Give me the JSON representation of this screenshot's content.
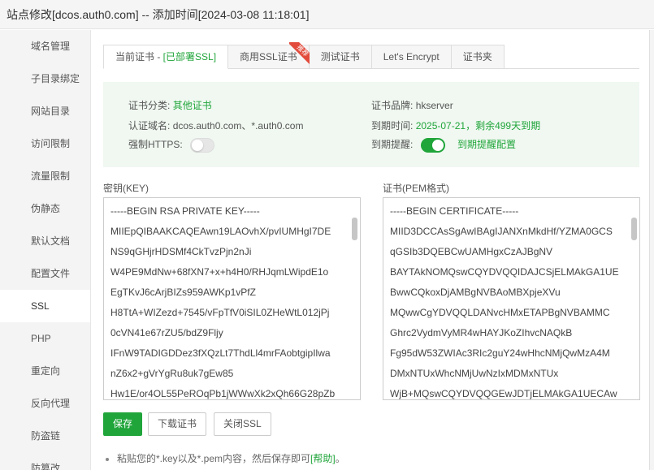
{
  "window": {
    "title": "站点修改[dcos.auth0.com] -- 添加时间[2024-03-08 11:18:01]"
  },
  "sidebar": {
    "items": [
      {
        "label": "域名管理"
      },
      {
        "label": "子目录绑定"
      },
      {
        "label": "网站目录"
      },
      {
        "label": "访问限制"
      },
      {
        "label": "流量限制"
      },
      {
        "label": "伪静态"
      },
      {
        "label": "默认文档"
      },
      {
        "label": "配置文件"
      },
      {
        "label": "SSL"
      },
      {
        "label": "PHP"
      },
      {
        "label": "重定向"
      },
      {
        "label": "反向代理"
      },
      {
        "label": "防盗链"
      },
      {
        "label": "防篡改"
      }
    ],
    "active": "SSL"
  },
  "tabs": {
    "current_prefix": "当前证书 - ",
    "current_status": "[已部署SSL]",
    "commercial": "商用SSL证书",
    "commercial_badge": "推荐",
    "test": "测试证书",
    "letsencrypt": "Let's Encrypt",
    "folder": "证书夹"
  },
  "info": {
    "category_label": "证书分类:",
    "category_value": "其他证书",
    "brand_label": "证书品牌:",
    "brand_value": "hkserver",
    "domain_label": "认证域名:",
    "domain_value": "dcos.auth0.com、*.auth0.com",
    "expire_label": "到期时间:",
    "expire_value": "2025-07-21，剩余499天到期",
    "https_label": "强制HTTPS:",
    "https_enabled": false,
    "reminder_label": "到期提醒:",
    "reminder_enabled": true,
    "reminder_config": "到期提醒配置"
  },
  "key": {
    "label": "密钥(KEY)",
    "lines": [
      "-----BEGIN RSA PRIVATE KEY-----",
      "MIIEpQIBAAKCAQEAwn19LAOvhX/pvIUMHgI7DE",
      "NS9qGHjrHDSMf4CkTvzPjn2nJi",
      "W4PE9MdNw+68fXN7+x+h4H0/RHJqmLWipdE1o",
      "EgTKvJ6cArjBIZs959AWKp1vPfZ",
      "H8TtA+WIZezd+7545/vFpTfV0iSIL0ZHeWtL012jPj",
      "0cVN41e67rZU5/bdZ9Fljy",
      "IFnW9TADIGDDez3fXQzLt7ThdLl4mrFAobtgipIlwa",
      "nZ6x2+gVrYgRu8uk7gEw85",
      "Hw1E/or4OL55PeROqPb1jWWwXk2xQh66G28pZb"
    ]
  },
  "cert": {
    "label": "证书(PEM格式)",
    "lines": [
      "-----BEGIN CERTIFICATE-----",
      "MIID3DCCAsSgAwIBAgIJANXnMkdHf/YZMA0GCS",
      "qGSIb3DQEBCwUAMHgxCzAJBgNV",
      "BAYTAkNOMQswCQYDVQQIDAJCSjELMAkGA1UE",
      "BwwCQkoxDjAMBgNVBAoMBXpjeXVu",
      "MQwwCgYDVQQLDANvcHMxETAPBgNVBAMMC",
      "Ghrc2VydmVyMR4wHAYJKoZIhvcNAQkB",
      "Fg95dW53ZWIAc3RIc2guY24wHhcNMjQwMzA4M",
      "DMxNTUxWhcNMjUwNzIxMDMxNTUx",
      "WjB+MQswCQYDVQQGEwJDTjELMAkGA1UECAw"
    ]
  },
  "buttons": {
    "save": "保存",
    "download": "下载证书",
    "disable": "关闭SSL"
  },
  "tip": {
    "text": "粘贴您的*.key以及*.pem内容，然后保存即可",
    "help": "[帮助]",
    "end": "。"
  }
}
